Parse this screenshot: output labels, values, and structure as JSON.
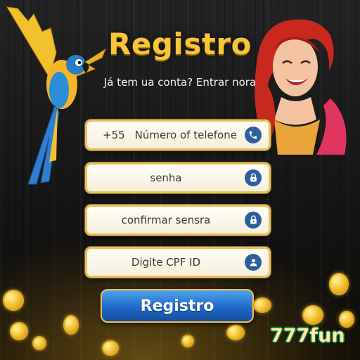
{
  "header": {
    "title": "Registro",
    "subtitle": "Já tem ua conta? Entrar nora"
  },
  "form": {
    "phone": {
      "prefix": "+55",
      "placeholder": "Número of telefone",
      "icon": "phone-icon"
    },
    "password": {
      "placeholder": "senha",
      "icon": "lock-icon"
    },
    "confirm_password": {
      "placeholder": "confirmar sensra",
      "icon": "lock-icon"
    },
    "cpf": {
      "placeholder": "Digite CPF ID",
      "icon": "user-icon"
    },
    "submit_label": "Registro"
  },
  "brand": {
    "logo": "777fun"
  },
  "colors": {
    "title": "#f8c53a",
    "field_border": "#e8c15e",
    "icon_bg": "#2b5f9e",
    "button": "#1f68c8",
    "logo_outline": "#0c6d3e"
  }
}
